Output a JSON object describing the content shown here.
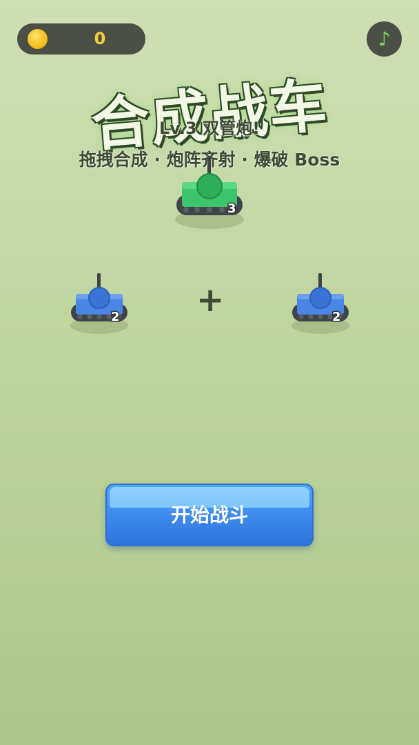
{
  "hud": {
    "coin_icon": "gold-coin-icon",
    "coin_count": "0",
    "music_icon": "music-note-icon",
    "music_glyph": "♪"
  },
  "title": {
    "main": "合成战车",
    "level": "Lv.3 双管炮!",
    "subtitle": "拖拽合成 · 炮阵齐射 · 爆破 Boss"
  },
  "merge_demo": {
    "result_tank": {
      "level": "3",
      "color": "#3cc46a"
    },
    "left_tank": {
      "level": "2",
      "color": "#4a86e6"
    },
    "right_tank": {
      "level": "2",
      "color": "#4a86e6"
    },
    "plus_symbol": "+"
  },
  "start_button": {
    "label": "开始战斗"
  },
  "colors": {
    "hud_bg": "#4a5046",
    "coin_text": "#f7cf3d",
    "button_blue": "#3b86ea",
    "tread": "#3f4548"
  }
}
